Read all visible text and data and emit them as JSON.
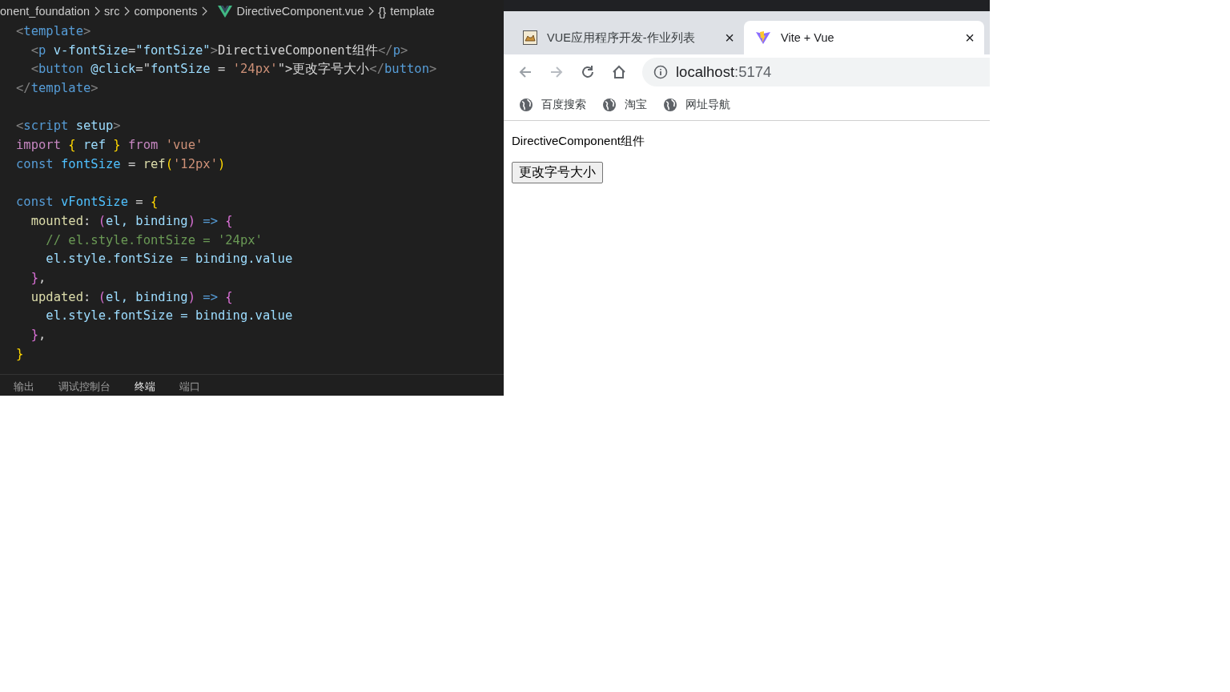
{
  "editor": {
    "breadcrumb": [
      {
        "label": "onent_foundation",
        "kind": "folder"
      },
      {
        "label": "src",
        "kind": "folder"
      },
      {
        "label": "components",
        "kind": "folder"
      },
      {
        "label": "DirectiveComponent.vue",
        "kind": "file"
      },
      {
        "label": "template",
        "kind": "symbol",
        "symbol": "{}"
      }
    ],
    "lines": [
      {
        "kind": "code",
        "tokens": [
          {
            "t": "<",
            "kind": "punct"
          },
          {
            "t": "template",
            "kind": "tag"
          },
          {
            "t": ">",
            "kind": "punct"
          }
        ]
      },
      {
        "kind": "code",
        "tokens": [
          {
            "t": "  <",
            "kind": "punct"
          },
          {
            "t": "p",
            "kind": "tag"
          },
          {
            "t": " v-fontSize",
            "kind": "attr"
          },
          {
            "t": "=",
            "kind": "text"
          },
          {
            "t": "\"fontSize\"",
            "kind": "attr"
          },
          {
            "t": ">",
            "kind": "punct"
          },
          {
            "t": "DirectiveComponent组件",
            "kind": "text"
          },
          {
            "t": "</",
            "kind": "punct"
          },
          {
            "t": "p",
            "kind": "tag"
          },
          {
            "t": ">",
            "kind": "punct"
          }
        ]
      },
      {
        "kind": "code",
        "tokens": [
          {
            "t": "  <",
            "kind": "punct"
          },
          {
            "t": "button",
            "kind": "tag"
          },
          {
            "t": " @click",
            "kind": "attr"
          },
          {
            "t": "=\"",
            "kind": "text"
          },
          {
            "t": "fontSize",
            "kind": "attr"
          },
          {
            "t": " = ",
            "kind": "text"
          },
          {
            "t": "'24px'",
            "kind": "string"
          },
          {
            "t": "\">更改字号大小",
            "kind": "text"
          },
          {
            "t": "</",
            "kind": "punct"
          },
          {
            "t": "button",
            "kind": "tag"
          },
          {
            "t": ">",
            "kind": "punct"
          }
        ]
      },
      {
        "kind": "code",
        "tokens": [
          {
            "t": "</",
            "kind": "punct"
          },
          {
            "t": "template",
            "kind": "tag"
          },
          {
            "t": ">",
            "kind": "punct"
          }
        ]
      },
      {
        "kind": "blank"
      },
      {
        "kind": "code",
        "tokens": [
          {
            "t": "<",
            "kind": "punct"
          },
          {
            "t": "script",
            "kind": "tag"
          },
          {
            "t": " setup",
            "kind": "attr"
          },
          {
            "t": ">",
            "kind": "punct"
          }
        ]
      },
      {
        "kind": "code",
        "tokens": [
          {
            "t": "import",
            "kind": "keyword"
          },
          {
            "t": " { ",
            "kind": "brace"
          },
          {
            "t": "ref",
            "kind": "attr"
          },
          {
            "t": " } ",
            "kind": "brace"
          },
          {
            "t": "from",
            "kind": "keyword"
          },
          {
            "t": " 'vue'",
            "kind": "string"
          }
        ]
      },
      {
        "kind": "code",
        "tokens": [
          {
            "t": "const",
            "kind": "storage"
          },
          {
            "t": " fontSize",
            "kind": "variable"
          },
          {
            "t": " = ",
            "kind": "text"
          },
          {
            "t": "ref",
            "kind": "func"
          },
          {
            "t": "(",
            "kind": "brace"
          },
          {
            "t": "'12px'",
            "kind": "string"
          },
          {
            "t": ")",
            "kind": "brace"
          }
        ]
      },
      {
        "kind": "blank"
      },
      {
        "kind": "code",
        "tokens": [
          {
            "t": "const",
            "kind": "storage"
          },
          {
            "t": " vFontSize",
            "kind": "variable"
          },
          {
            "t": " = ",
            "kind": "text"
          },
          {
            "t": "{",
            "kind": "brace"
          }
        ]
      },
      {
        "kind": "code",
        "tokens": [
          {
            "t": "  mounted",
            "kind": "func"
          },
          {
            "t": ": ",
            "kind": "text"
          },
          {
            "t": "(",
            "kind": "brace2"
          },
          {
            "t": "el, binding",
            "kind": "attr"
          },
          {
            "t": ")",
            "kind": "brace2"
          },
          {
            "t": " => ",
            "kind": "storage"
          },
          {
            "t": "{",
            "kind": "brace2"
          }
        ]
      },
      {
        "kind": "code",
        "tokens": [
          {
            "t": "    // el.style.fontSize = '24px'",
            "kind": "comment"
          }
        ]
      },
      {
        "kind": "code",
        "tokens": [
          {
            "t": "    el.style.fontSize = binding.value",
            "kind": "attr"
          }
        ]
      },
      {
        "kind": "code",
        "tokens": [
          {
            "t": "  }",
            "kind": "brace2"
          },
          {
            "t": ",",
            "kind": "text"
          }
        ]
      },
      {
        "kind": "code",
        "tokens": [
          {
            "t": "  updated",
            "kind": "func"
          },
          {
            "t": ": ",
            "kind": "text"
          },
          {
            "t": "(",
            "kind": "brace2"
          },
          {
            "t": "el, binding",
            "kind": "attr"
          },
          {
            "t": ")",
            "kind": "brace2"
          },
          {
            "t": " => ",
            "kind": "storage"
          },
          {
            "t": "{",
            "kind": "brace2"
          }
        ]
      },
      {
        "kind": "code",
        "tokens": [
          {
            "t": "    el.style.fontSize = binding.value",
            "kind": "attr"
          }
        ]
      },
      {
        "kind": "code",
        "tokens": [
          {
            "t": "  }",
            "kind": "brace2"
          },
          {
            "t": ",",
            "kind": "text"
          }
        ]
      },
      {
        "kind": "code",
        "tokens": [
          {
            "t": "}",
            "kind": "brace"
          }
        ]
      }
    ],
    "panel_tabs": [
      {
        "label": "输出",
        "selected": false
      },
      {
        "label": "调试控制台",
        "selected": false
      },
      {
        "label": "终端",
        "selected": true
      },
      {
        "label": "端口",
        "selected": false
      }
    ]
  },
  "browser": {
    "tabs": [
      {
        "title": "VUE应用程序开发-作业列表",
        "selected": false,
        "close": "×"
      },
      {
        "title": "Vite + Vue",
        "selected": true,
        "close": "×"
      }
    ],
    "nav": [
      {
        "kind": "back",
        "disabled": false
      },
      {
        "kind": "forward",
        "disabled": true
      },
      {
        "kind": "reload",
        "disabled": false
      },
      {
        "kind": "home",
        "disabled": false
      }
    ],
    "address": {
      "host": "localhost",
      "port": ":5174"
    },
    "bookmarks": [
      {
        "label": "百度搜索"
      },
      {
        "label": "淘宝"
      },
      {
        "label": "网址导航"
      }
    ],
    "page": {
      "paragraph": "DirectiveComponent组件",
      "button": "更改字号大小"
    }
  }
}
